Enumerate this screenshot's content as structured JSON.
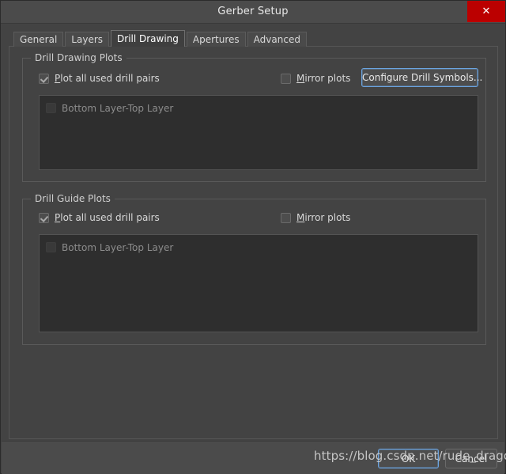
{
  "window": {
    "title": "Gerber Setup",
    "close_label": "✕",
    "accent_focus_color": "#6ba4e0",
    "close_color": "#bb0000",
    "bg_color": "#434343"
  },
  "tabs": [
    {
      "label": "General",
      "active": false
    },
    {
      "label": "Layers",
      "active": false
    },
    {
      "label": "Drill Drawing",
      "active": true
    },
    {
      "label": "Apertures",
      "active": false
    },
    {
      "label": "Advanced",
      "active": false
    }
  ],
  "drill_drawing_plots": {
    "legend": "Drill Drawing Plots",
    "plot_all_mnemonic": "P",
    "plot_all_rest": "lot all used drill pairs",
    "plot_all_checked": true,
    "mirror_mnemonic": "M",
    "mirror_rest": "irror plots",
    "mirror_checked": false,
    "configure_button": "Configure Drill Symbols...",
    "list_items": [
      {
        "label": "Bottom Layer-Top Layer",
        "checked": false
      }
    ]
  },
  "drill_guide_plots": {
    "legend": "Drill Guide Plots",
    "plot_all_mnemonic": "P",
    "plot_all_rest": "lot all used drill pairs",
    "plot_all_checked": true,
    "mirror_mnemonic": "M",
    "mirror_rest": "irror plots",
    "mirror_checked": false,
    "list_items": [
      {
        "label": "Bottom Layer-Top Layer",
        "checked": false
      }
    ]
  },
  "footer": {
    "ok_label": "OK",
    "cancel_label": "Cancel"
  },
  "watermark": {
    "text": "https://blog.csdn.net/rude_dragon"
  }
}
